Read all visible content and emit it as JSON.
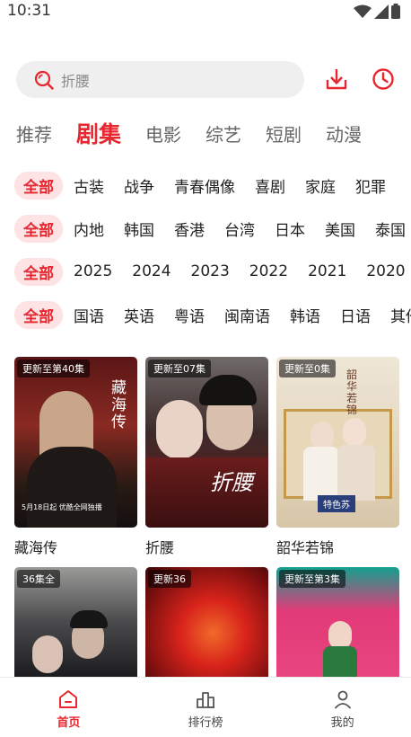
{
  "status_bar": {
    "time": "10:31"
  },
  "search": {
    "placeholder": "折腰"
  },
  "header_buttons": {
    "download": "download-icon",
    "history": "clock-icon"
  },
  "tabs": [
    {
      "label": "推荐",
      "active": false
    },
    {
      "label": "剧集",
      "active": true
    },
    {
      "label": "电影",
      "active": false
    },
    {
      "label": "综艺",
      "active": false
    },
    {
      "label": "短剧",
      "active": false
    },
    {
      "label": "动漫",
      "active": false
    }
  ],
  "filters": {
    "genre": [
      "全部",
      "古装",
      "战争",
      "青春偶像",
      "喜剧",
      "家庭",
      "犯罪"
    ],
    "region": [
      "全部",
      "内地",
      "韩国",
      "香港",
      "台湾",
      "日本",
      "美国",
      "泰国"
    ],
    "year": [
      "全部",
      "2025",
      "2024",
      "2023",
      "2022",
      "2021",
      "2020"
    ],
    "language": [
      "全部",
      "国语",
      "英语",
      "粤语",
      "闽南语",
      "韩语",
      "日语",
      "其他"
    ]
  },
  "cards": [
    {
      "title": "藏海传",
      "badge": "更新至第40集",
      "poster_text": "藏海传",
      "poster_caption": "5月18日起 优酷全网独播"
    },
    {
      "title": "折腰",
      "badge": "更新至07集",
      "poster_text": "折腰",
      "poster_caption": ""
    },
    {
      "title": "韶华若锦",
      "badge": "更新至0集",
      "poster_text": "韶华若锦",
      "poster_caption": "特色苏"
    },
    {
      "title": "",
      "badge": "36集全",
      "poster_text": "",
      "poster_caption": ""
    },
    {
      "title": "",
      "badge": "更新36",
      "poster_text": "",
      "poster_caption": ""
    },
    {
      "title": "",
      "badge": "更新至第3集",
      "poster_text": "",
      "poster_caption": ""
    }
  ],
  "bottom_nav": [
    {
      "label": "首页",
      "icon": "home-icon",
      "active": true
    },
    {
      "label": "排行榜",
      "icon": "ranking-icon",
      "active": false
    },
    {
      "label": "我的",
      "icon": "user-icon",
      "active": false
    }
  ],
  "colors": {
    "accent": "#e8262f",
    "chip_bg": "#fde3e3",
    "search_bg": "#efefef"
  }
}
